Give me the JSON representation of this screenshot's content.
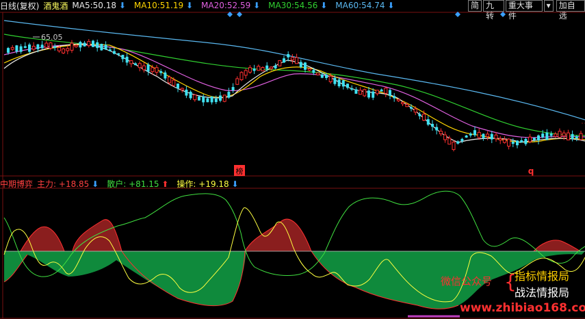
{
  "header": {
    "period": "日线(复权)",
    "name": "酒鬼酒",
    "ma": [
      {
        "label": "MA5:",
        "value": "50.18",
        "color": "#e8e8e8",
        "dir": "down"
      },
      {
        "label": "MA10:",
        "value": "51.19",
        "color": "#ffd500",
        "dir": "down"
      },
      {
        "label": "MA20:",
        "value": "52.59",
        "color": "#e060e0",
        "dir": "down"
      },
      {
        "label": "MA30:",
        "value": "54.56",
        "color": "#30d030",
        "dir": "down"
      },
      {
        "label": "MA60:",
        "value": "54.74",
        "color": "#5ab8f0",
        "dir": "down"
      }
    ]
  },
  "toolbar": {
    "simple": "简",
    "nine_turn": "九转",
    "major_events": "重大事件",
    "dropdown": "▾",
    "add_self": "加自选"
  },
  "price_marker": "65.05",
  "badges": {
    "bang": "榜",
    "q": "q"
  },
  "indicator": {
    "name": "中期博弈",
    "items": [
      {
        "label": "主力:",
        "value": "+18.85",
        "color": "#ff4040",
        "dir": "down"
      },
      {
        "label": "散户:",
        "value": "+81.15",
        "color": "#40e040",
        "dir": "up"
      },
      {
        "label": "操作:",
        "value": "+19.18",
        "color": "#ffff40",
        "dir": "down"
      }
    ]
  },
  "promo": {
    "wechat": "微信公众号",
    "line1": "指标情报局",
    "line2": "战法情报局",
    "url": "www.zhibiao168.com"
  },
  "colors": {
    "up": "#ff3030",
    "down": "#3aa0ff",
    "candle_down": "#40e0f0",
    "grid": "#7a1010"
  }
}
